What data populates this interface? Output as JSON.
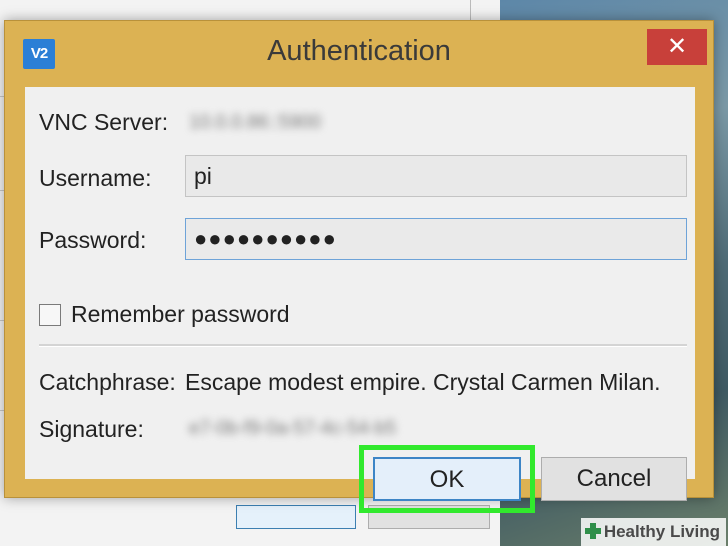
{
  "dialog": {
    "title": "Authentication",
    "logo_text": "V2",
    "close_glyph": "✕",
    "vnc_server_label": "VNC Server:",
    "vnc_server_value": "10.0.0.86::5900",
    "username_label": "Username:",
    "username_value": "pi",
    "password_label": "Password:",
    "password_value": "●●●●●●●●●●",
    "remember_label": "Remember password",
    "remember_checked": false,
    "catchphrase_label": "Catchphrase:",
    "catchphrase_value": "Escape modest empire. Crystal Carmen Milan.",
    "signature_label": "Signature:",
    "signature_value": "e7-0b-f9-0a-57-4c-54-b5",
    "ok_label": "OK",
    "cancel_label": "Cancel"
  },
  "watermark": {
    "text": "Healthy Living"
  },
  "colors": {
    "dialog_frame": "#dcb253",
    "close_button": "#c8403a",
    "logo": "#2b7fd6",
    "highlight": "#31e92d",
    "ok_border": "#3d85c6"
  }
}
